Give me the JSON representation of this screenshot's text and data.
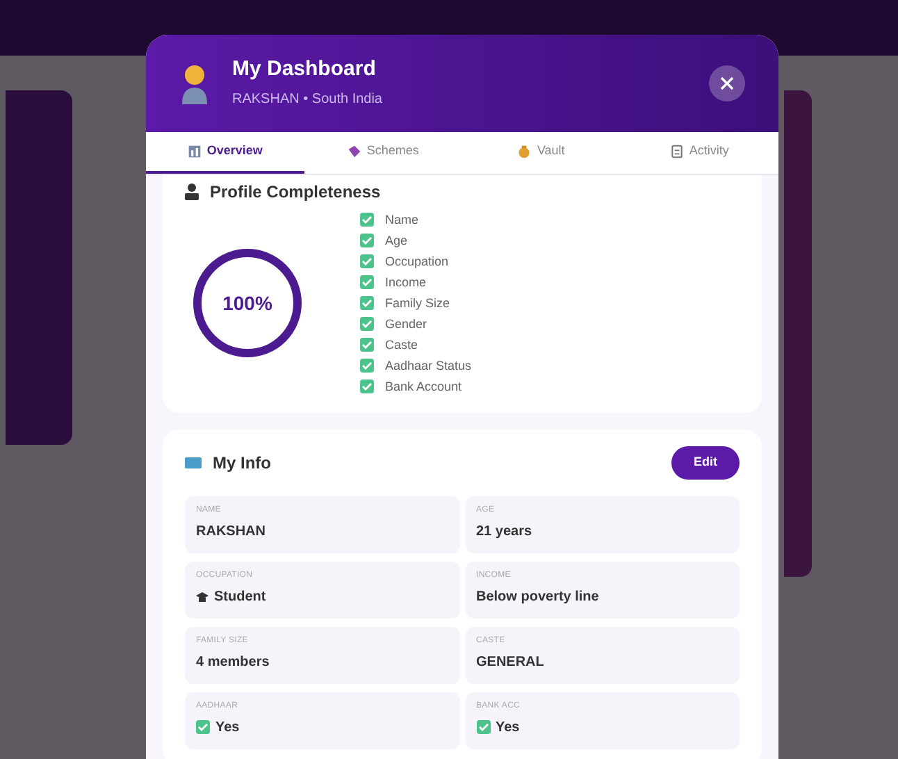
{
  "header": {
    "title": "My Dashboard",
    "subtitle": "RAKSHAN • South India"
  },
  "tabs": [
    {
      "label": "Overview",
      "selected": true
    },
    {
      "label": "Schemes",
      "selected": false
    },
    {
      "label": "Vault",
      "selected": false
    },
    {
      "label": "Activity",
      "selected": false
    }
  ],
  "profile_completeness": {
    "title": "Profile Completeness",
    "percent": "100%",
    "level": 1,
    "items": [
      {
        "label": "Name",
        "checked": true
      },
      {
        "label": "Age",
        "checked": true
      },
      {
        "label": "Occupation",
        "checked": true
      },
      {
        "label": "Income",
        "checked": true
      },
      {
        "label": "Family Size",
        "checked": true
      },
      {
        "label": "Gender",
        "checked": true
      },
      {
        "label": "Caste",
        "checked": true
      },
      {
        "label": "Aadhaar Status",
        "checked": true
      },
      {
        "label": "Bank Account",
        "checked": true
      }
    ]
  },
  "my_info": {
    "title": "My Info",
    "edit_button": "Edit",
    "fields": [
      {
        "kind": "text",
        "label": "NAME",
        "value": "RAKSHAN"
      },
      {
        "kind": "text",
        "label": "AGE",
        "value": "21 years"
      },
      {
        "kind": "occupation",
        "label": "OCCUPATION",
        "value": "Student"
      },
      {
        "kind": "text",
        "label": "INCOME",
        "value": "Below poverty line"
      },
      {
        "kind": "text",
        "label": "FAMILY SIZE",
        "value": "4 members"
      },
      {
        "kind": "text",
        "label": "CASTE",
        "value": "GENERAL"
      },
      {
        "kind": "check",
        "label": "AADHAAR",
        "value": "Yes"
      },
      {
        "kind": "check",
        "label": "BANK ACC",
        "value": "Yes"
      }
    ]
  }
}
